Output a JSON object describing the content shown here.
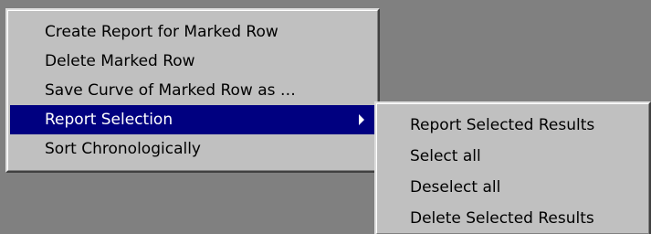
{
  "context_menu": {
    "items": [
      {
        "label": "Create Report for Marked Row"
      },
      {
        "label": "Delete Marked Row"
      },
      {
        "label": "Save Curve of Marked Row as …"
      },
      {
        "label": "Report Selection",
        "has_submenu": true,
        "highlighted": true
      },
      {
        "label": "Sort Chronologically"
      }
    ]
  },
  "submenu": {
    "items": [
      {
        "label": "Report Selected Results"
      },
      {
        "label": "Select all"
      },
      {
        "label": "Deselect all"
      },
      {
        "label": "Delete Selected Results"
      }
    ]
  },
  "colors": {
    "menu_face": "#c0c0c0",
    "highlight": "#000080",
    "desktop": "#808080"
  },
  "icons": {
    "submenu_arrow": "triangle-right-icon"
  }
}
